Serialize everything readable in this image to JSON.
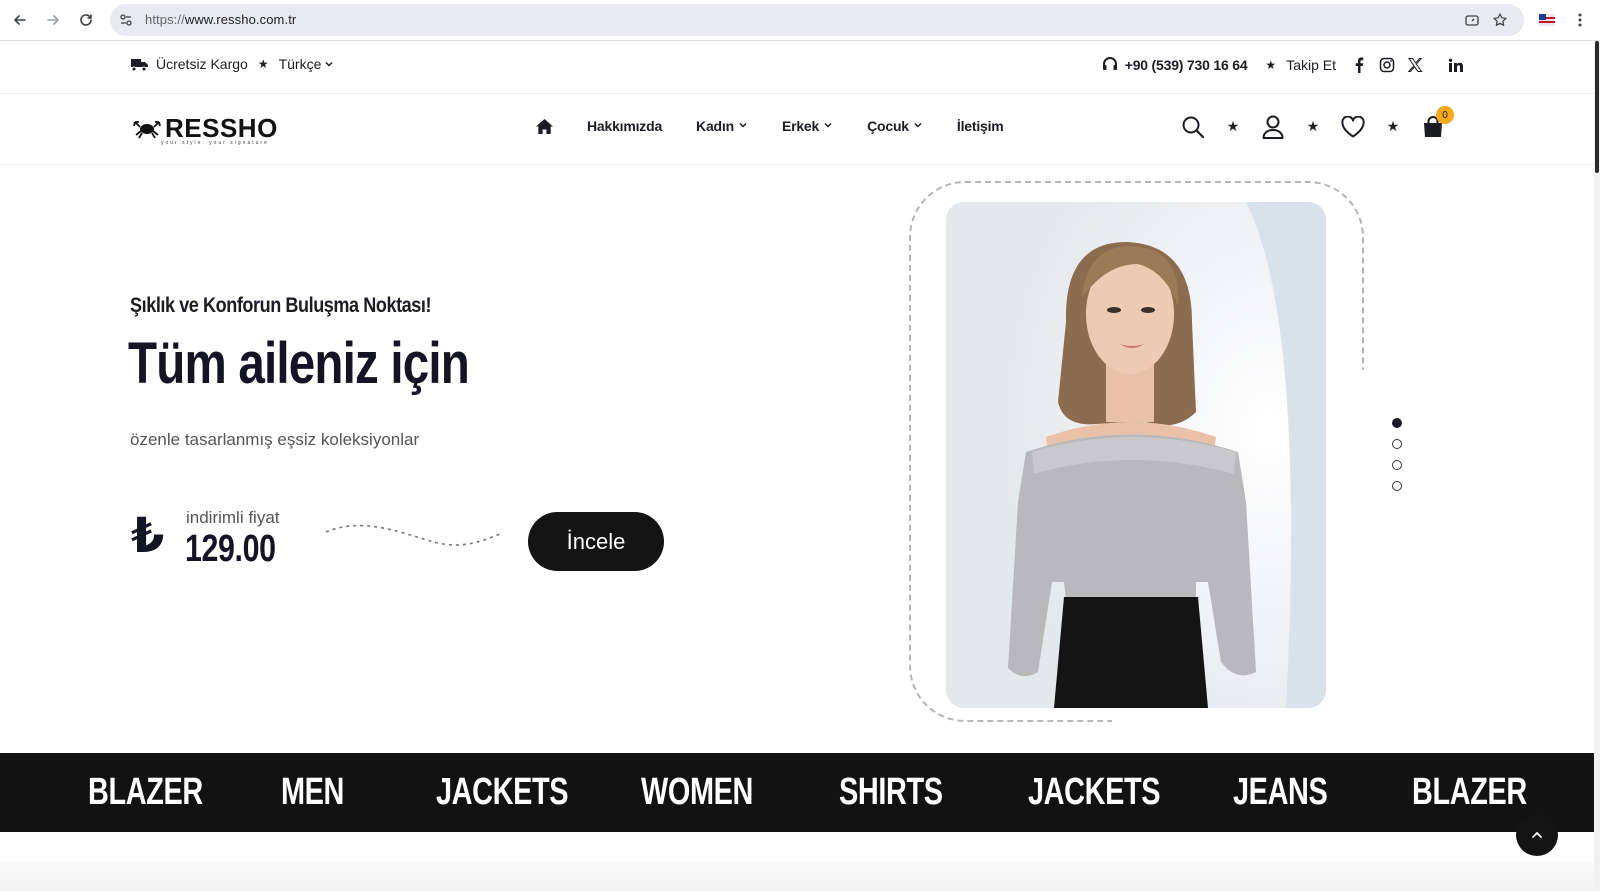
{
  "browser": {
    "url_scheme": "https://",
    "url_host": "www.ressho.com.tr"
  },
  "topbar": {
    "shipping": "Ücretsiz Kargo",
    "language": "Türkçe",
    "phone": "+90 (539) 730 16 64",
    "follow": "Takip Et"
  },
  "header": {
    "logo": "RESSHO",
    "logo_tagline": "your style. your signature",
    "menu": [
      {
        "label": "Hakkımızda"
      },
      {
        "label": "Kadın"
      },
      {
        "label": "Erkek"
      },
      {
        "label": "Çocuk"
      },
      {
        "label": "İletişim"
      }
    ],
    "cart_count": "0"
  },
  "hero": {
    "kicker": "Şıklık ve Konforun Buluşma Noktası!",
    "title": "Tüm aileniz için",
    "subtitle": "özenle tasarlanmış eşsiz koleksiyonlar",
    "currency_symbol": "₺",
    "price_label": "indirimli fiyat",
    "price": "129.00",
    "cta": "İncele",
    "active_slide": 1,
    "slide_count": 4
  },
  "categories": [
    "BLAZER",
    "MEN",
    "JACKETS",
    "WOMEN",
    "SHIRTS",
    "JACKETS",
    "JEANS",
    "BLAZER"
  ],
  "colors": {
    "accent": "#f4a91a",
    "dark": "#141414",
    "text": "#1c1c24"
  }
}
